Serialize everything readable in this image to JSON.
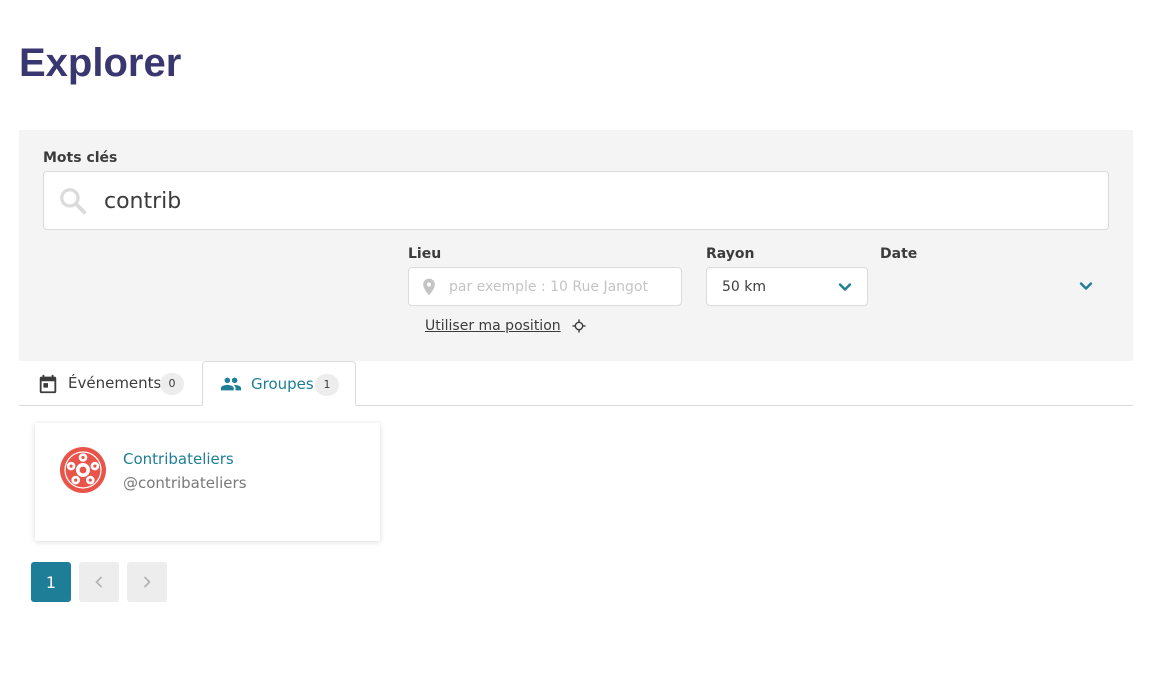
{
  "page": {
    "title": "Explorer"
  },
  "search": {
    "keywords_label": "Mots clés",
    "keywords_value": "contrib",
    "lieu_label": "Lieu",
    "lieu_placeholder": "par exemple : 10 Rue Jangot",
    "rayon_label": "Rayon",
    "rayon_value": "50 km",
    "date_label": "Date",
    "date_value": "",
    "use_position_label": "Utiliser ma position"
  },
  "tabs": [
    {
      "label": "Événements",
      "count": "0",
      "icon": "calendar-icon",
      "active": false
    },
    {
      "label": "Groupes",
      "count": "1",
      "icon": "people-icon",
      "active": true
    }
  ],
  "results": [
    {
      "name": "Contribateliers",
      "handle": "@contribateliers",
      "icon": "group-logo"
    }
  ],
  "pagination": {
    "current": "1"
  },
  "colors": {
    "accent": "#1e7d97",
    "title": "#3a3670",
    "panel": "#f4f4f4",
    "logo": "#e8534a"
  }
}
